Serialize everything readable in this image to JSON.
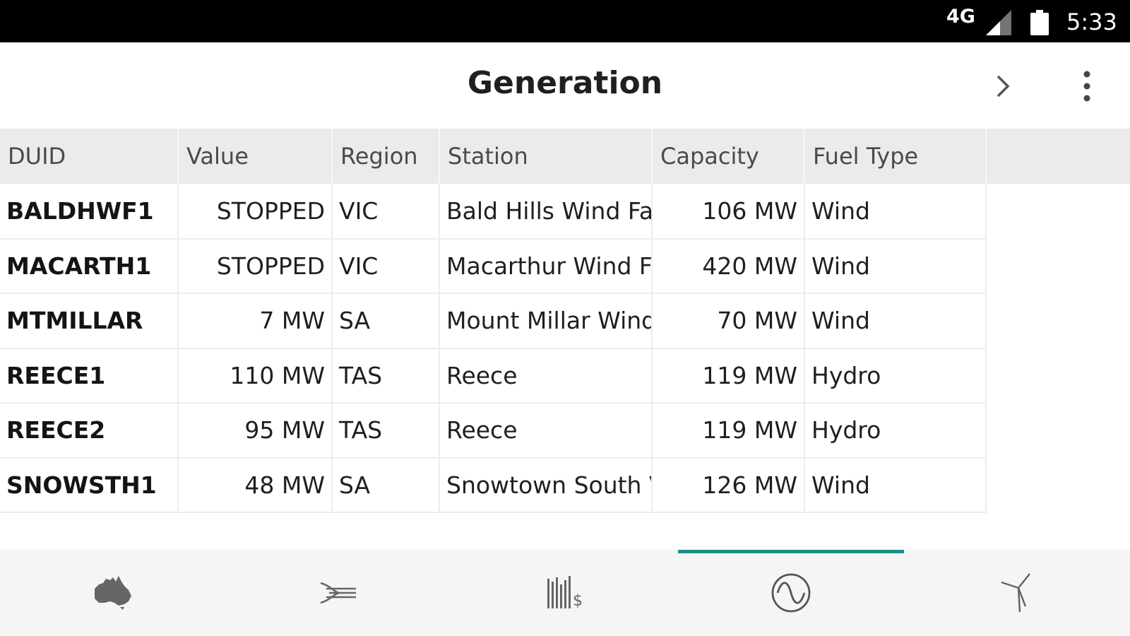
{
  "status_bar": {
    "network": "4G",
    "time": "5:33",
    "icons": [
      "signal-icon",
      "battery-icon"
    ]
  },
  "app_bar": {
    "title": "Generation",
    "icons": [
      "chevron-right-icon",
      "more-vert-icon"
    ]
  },
  "table": {
    "columns": [
      "DUID",
      "Value",
      "Region",
      "Station",
      "Capacity",
      "Fuel Type"
    ],
    "rows": [
      {
        "duid": "BALDHWF1",
        "value": "STOPPED",
        "region": "VIC",
        "station": "Bald Hills Wind Far",
        "capacity": "106 MW",
        "fuel": "Wind"
      },
      {
        "duid": "MACARTH1",
        "value": "STOPPED",
        "region": "VIC",
        "station": "Macarthur Wind Fa",
        "capacity": "420 MW",
        "fuel": "Wind"
      },
      {
        "duid": "MTMILLAR",
        "value": "7 MW",
        "region": "SA",
        "station": "Mount Millar Wind",
        "capacity": "70 MW",
        "fuel": "Wind"
      },
      {
        "duid": "REECE1",
        "value": "110 MW",
        "region": "TAS",
        "station": "Reece",
        "capacity": "119 MW",
        "fuel": "Hydro"
      },
      {
        "duid": "REECE2",
        "value": "95 MW",
        "region": "TAS",
        "station": "Reece",
        "capacity": "119 MW",
        "fuel": "Hydro"
      },
      {
        "duid": "SNOWSTH1",
        "value": "48 MW",
        "region": "SA",
        "station": "Snowtown South V",
        "capacity": "126 MW",
        "fuel": "Wind"
      }
    ]
  },
  "bottom_nav": {
    "items": [
      {
        "icon": "australia-map-icon",
        "selected": false
      },
      {
        "icon": "interconnector-icon",
        "selected": false
      },
      {
        "icon": "price-bars-icon",
        "selected": false
      },
      {
        "icon": "generation-wave-icon",
        "selected": true
      },
      {
        "icon": "wind-turbine-icon",
        "selected": false
      }
    ],
    "accent_color": "#1c8f82"
  }
}
